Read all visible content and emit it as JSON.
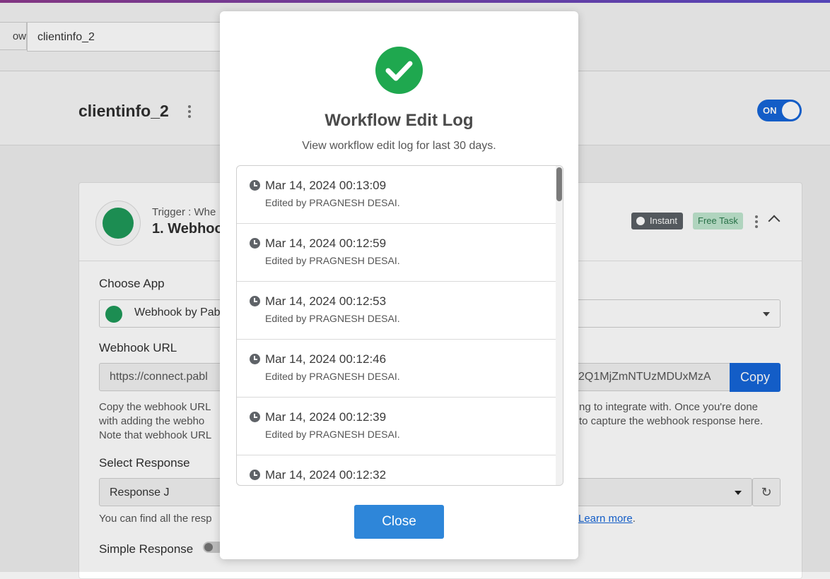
{
  "breadcrumb": {
    "prev": "ow",
    "current": "clientinfo_2"
  },
  "header": {
    "title": "clientinfo_2",
    "toggle_label": "ON"
  },
  "trigger": {
    "subtitle": "Trigger : Whe",
    "title": "1. Webhoo",
    "badge_instant": "Instant",
    "badge_free": "Free Task"
  },
  "form": {
    "choose_app_label": "Choose App",
    "choose_app_value": "Webhook by Pab",
    "webhook_url_label": "Webhook URL",
    "webhook_url_left": "https://connect.pabl",
    "webhook_url_right": "2Q1MjZmNTUzMDUxMzA",
    "copy_label": "Copy",
    "help_left": [
      "Copy the webhook URL",
      "with adding the webho",
      "Note that webhook URL"
    ],
    "help_right": [
      "ng to integrate with. Once you're done",
      "to capture the webhook response here."
    ],
    "select_response_label": "Select Response",
    "select_response_value": "Response J",
    "find_text": "You can find all the resp",
    "learn_more": "Learn more",
    "learn_more_suffix": ".",
    "simple_response_label": "Simple Response"
  },
  "modal": {
    "title": "Workflow Edit Log",
    "subtitle": "View workflow edit log for last 30 days.",
    "entries": [
      {
        "time": "Mar 14, 2024 00:13:09",
        "by": "Edited by PRAGNESH DESAI."
      },
      {
        "time": "Mar 14, 2024 00:12:59",
        "by": "Edited by PRAGNESH DESAI."
      },
      {
        "time": "Mar 14, 2024 00:12:53",
        "by": "Edited by PRAGNESH DESAI."
      },
      {
        "time": "Mar 14, 2024 00:12:46",
        "by": "Edited by PRAGNESH DESAI."
      },
      {
        "time": "Mar 14, 2024 00:12:39",
        "by": "Edited by PRAGNESH DESAI."
      },
      {
        "time": "Mar 14, 2024 00:12:32",
        "by": ""
      }
    ],
    "close_label": "Close"
  },
  "colors": {
    "accent": "#1565d8",
    "success": "#1fa84f",
    "close_button": "#2e86d9"
  }
}
